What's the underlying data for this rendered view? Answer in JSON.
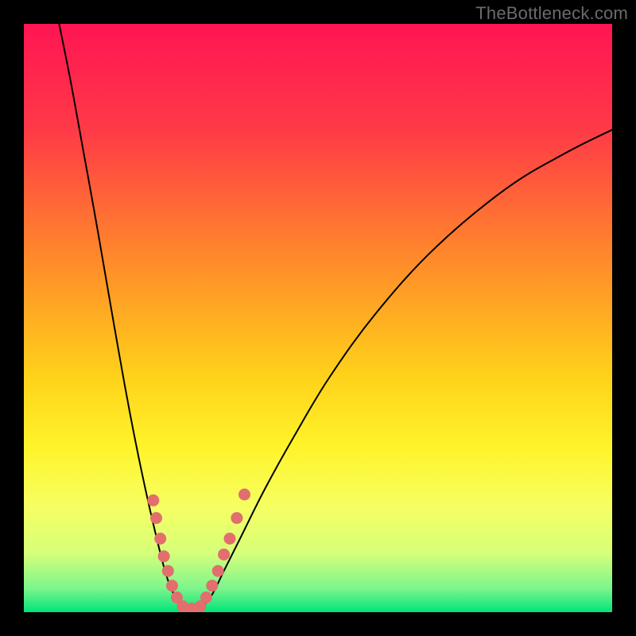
{
  "watermark": "TheBottleneck.com",
  "colors": {
    "frame": "#000000",
    "watermark": "#6b6b6b",
    "gradient_stops": [
      {
        "offset": 0.0,
        "color": "#ff1553"
      },
      {
        "offset": 0.18,
        "color": "#ff3a47"
      },
      {
        "offset": 0.4,
        "color": "#ff8a2a"
      },
      {
        "offset": 0.6,
        "color": "#ffd21a"
      },
      {
        "offset": 0.72,
        "color": "#fff42a"
      },
      {
        "offset": 0.82,
        "color": "#f6ff62"
      },
      {
        "offset": 0.9,
        "color": "#d6ff7a"
      },
      {
        "offset": 0.96,
        "color": "#7cf58c"
      },
      {
        "offset": 1.0,
        "color": "#00e47a"
      }
    ],
    "curve": "#000000",
    "marker_fill": "#e26e6e",
    "marker_stroke": "#8a3a3a"
  },
  "chart_data": {
    "type": "line",
    "title": "",
    "xlabel": "",
    "ylabel": "",
    "xlim": [
      0,
      100
    ],
    "ylim": [
      0,
      100
    ],
    "series": [
      {
        "name": "left-curve",
        "x": [
          6,
          8,
          10,
          12,
          14,
          16,
          18,
          20,
          22,
          24,
          25.5,
          27
        ],
        "y": [
          100,
          90,
          79,
          68,
          56.5,
          45,
          34,
          24,
          15,
          7,
          3,
          0.5
        ]
      },
      {
        "name": "right-curve",
        "x": [
          30,
          32,
          34,
          37,
          41,
          46,
          52,
          60,
          70,
          82,
          92,
          100
        ],
        "y": [
          0.5,
          3,
          7,
          13,
          21,
          30,
          40,
          51,
          62,
          72,
          78,
          82
        ]
      },
      {
        "name": "valley-floor",
        "x": [
          27,
          28.5,
          30
        ],
        "y": [
          0.5,
          0.5,
          0.5
        ]
      }
    ],
    "markers": [
      {
        "x": 22.0,
        "y": 19.0
      },
      {
        "x": 22.5,
        "y": 16.0
      },
      {
        "x": 23.2,
        "y": 12.5
      },
      {
        "x": 23.8,
        "y": 9.5
      },
      {
        "x": 24.5,
        "y": 7.0
      },
      {
        "x": 25.2,
        "y": 4.5
      },
      {
        "x": 26.0,
        "y": 2.5
      },
      {
        "x": 27.0,
        "y": 1.0
      },
      {
        "x": 28.5,
        "y": 0.6
      },
      {
        "x": 30.0,
        "y": 1.0
      },
      {
        "x": 31.0,
        "y": 2.5
      },
      {
        "x": 32.0,
        "y": 4.5
      },
      {
        "x": 33.0,
        "y": 7.0
      },
      {
        "x": 34.0,
        "y": 9.8
      },
      {
        "x": 35.0,
        "y": 12.5
      },
      {
        "x": 36.2,
        "y": 16.0
      },
      {
        "x": 37.5,
        "y": 20.0
      }
    ]
  }
}
